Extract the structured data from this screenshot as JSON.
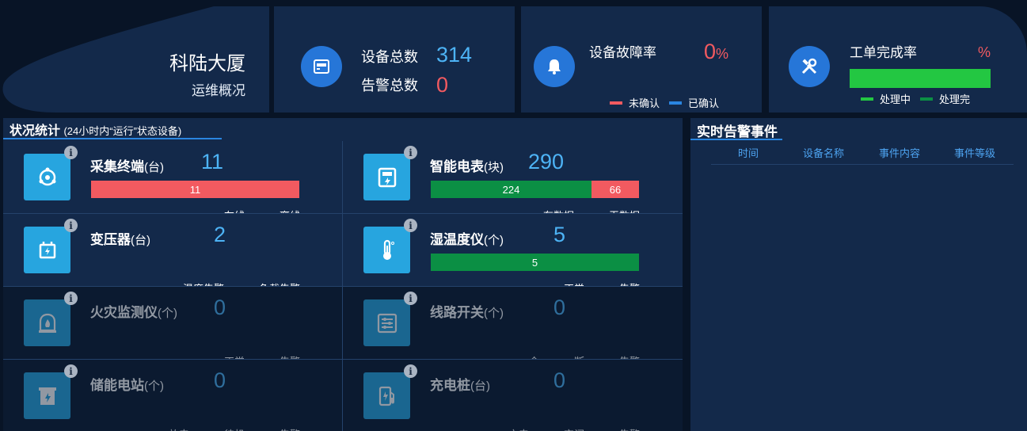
{
  "header": {
    "building_name": "科陆大厦",
    "subtitle": "运维概况",
    "device_total_label": "设备总数",
    "device_total_value": "314",
    "alarm_total_label": "告警总数",
    "alarm_total_value": "0",
    "fault_rate_label": "设备故障率",
    "fault_rate_value": "0",
    "fault_rate_unit": "%",
    "fault_legend": [
      {
        "label": "未确认",
        "color": "#f25a60"
      },
      {
        "label": "已确认",
        "color": "#2a85e0"
      }
    ],
    "workorder_label": "工单完成率",
    "workorder_unit": "%",
    "workorder_progress": 1.0,
    "workorder_legend": [
      {
        "label": "处理中",
        "color": "#23c742"
      },
      {
        "label": "处理完",
        "color": "#0b8f44"
      }
    ]
  },
  "status": {
    "title": "状况统计",
    "title_note": "(24小时内“运行”状态设备)",
    "cells": [
      {
        "name": "采集终端",
        "unit": "(台)",
        "count": "11",
        "bar": [
          {
            "value": "11",
            "share": 1.0,
            "color": "#f25a60"
          }
        ],
        "legend": [
          {
            "label": "在线",
            "color": "#0b8f44"
          },
          {
            "label": "离线",
            "color": "#f25a60"
          }
        ],
        "icon": "collector-icon",
        "dim": false
      },
      {
        "name": "智能电表",
        "unit": "(块)",
        "count": "290",
        "bar": [
          {
            "value": "224",
            "share": 0.772,
            "color": "#0b8f44"
          },
          {
            "value": "66",
            "share": 0.228,
            "color": "#f25a60"
          }
        ],
        "legend": [
          {
            "label": "有数据",
            "color": "#0b8f44"
          },
          {
            "label": "无数据",
            "color": "#f25a60"
          }
        ],
        "icon": "meter-icon",
        "dim": false
      },
      {
        "name": "变压器",
        "unit": "(台)",
        "count": "2",
        "bar": [],
        "legend": [
          {
            "label": "温度告警",
            "color": "#f2a421"
          },
          {
            "label": "负载告警",
            "color": "#f25a60"
          }
        ],
        "icon": "transformer-icon",
        "dim": false
      },
      {
        "name": "湿温度仪",
        "unit": "(个)",
        "count": "5",
        "bar": [
          {
            "value": "5",
            "share": 1.0,
            "color": "#0b8f44"
          }
        ],
        "legend": [
          {
            "label": "正常",
            "color": "#0b8f44"
          },
          {
            "label": "告警",
            "color": "#f25a60"
          }
        ],
        "icon": "thermometer-icon",
        "dim": false
      },
      {
        "name": "火灾监测仪",
        "unit": "(个)",
        "count": "0",
        "bar": [],
        "legend": [
          {
            "label": "正常",
            "color": "#0b8f44"
          },
          {
            "label": "告警",
            "color": "#f25a60"
          }
        ],
        "icon": "fire-monitor-icon",
        "dim": true
      },
      {
        "name": "线路开关",
        "unit": "(个)",
        "count": "0",
        "bar": [],
        "legend": [
          {
            "label": "合",
            "color": "#0b8f44"
          },
          {
            "label": "断",
            "color": "#f2a421"
          },
          {
            "label": "告警",
            "color": "#f25a60"
          }
        ],
        "icon": "switch-icon",
        "dim": true
      },
      {
        "name": "储能电站",
        "unit": "(个)",
        "count": "0",
        "bar": [],
        "legend": [
          {
            "label": "放电",
            "color": "#f2a421"
          },
          {
            "label": "待机",
            "color": "#2a85e0"
          },
          {
            "label": "告警",
            "color": "#f25a60"
          }
        ],
        "icon": "storage-icon",
        "dim": true
      },
      {
        "name": "充电桩",
        "unit": "(台)",
        "count": "0",
        "bar": [],
        "legend": [
          {
            "label": "充电",
            "color": "#0b8f44"
          },
          {
            "label": "空闲",
            "color": "#2a85e0"
          },
          {
            "label": "告警",
            "color": "#f25a60"
          }
        ],
        "icon": "charger-icon",
        "dim": true
      }
    ]
  },
  "alarms": {
    "title": "实时告警事件",
    "columns": [
      "时间",
      "设备名称",
      "事件内容",
      "事件等级"
    ]
  }
}
